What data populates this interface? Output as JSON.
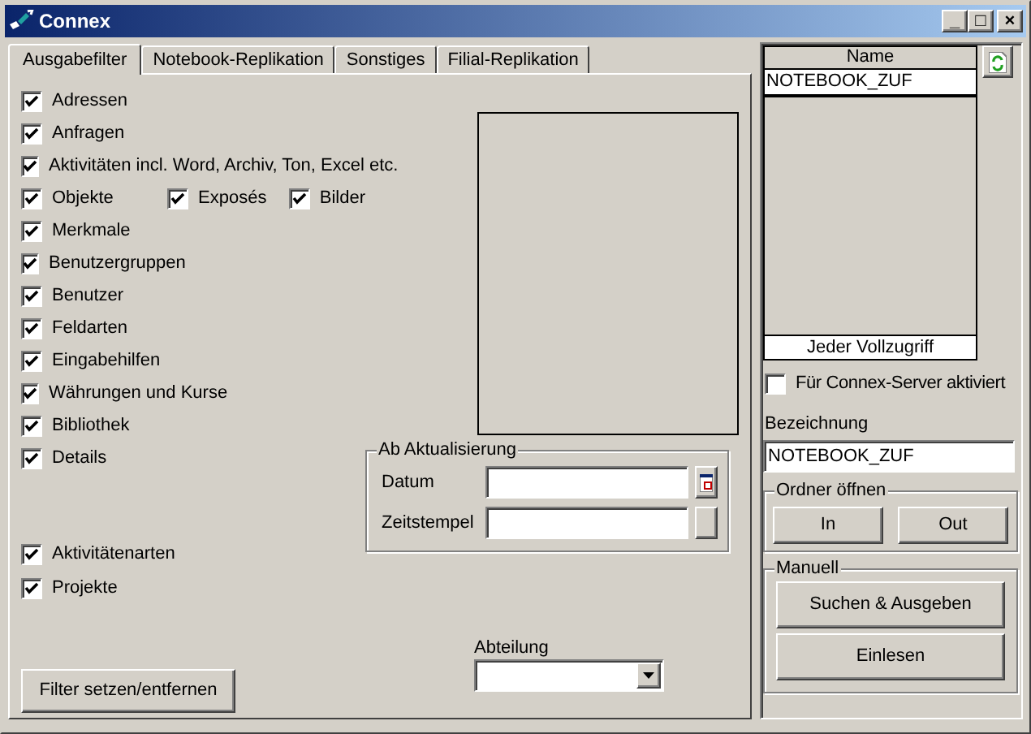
{
  "window": {
    "title": "Connex",
    "controls": [
      "_",
      "□",
      "×"
    ]
  },
  "tabs": [
    {
      "label": "Ausgabefilter",
      "selected": true
    },
    {
      "label": "Notebook-Replikation",
      "selected": false
    },
    {
      "label": "Sonstiges",
      "selected": false
    },
    {
      "label": "Filial-Replikation",
      "selected": false
    }
  ],
  "filters": [
    {
      "label": "Adressen",
      "checked": true
    },
    {
      "label": "Anfragen",
      "checked": true
    },
    {
      "label": "Aktivitäten incl. Word, Archiv, Ton, Excel etc.",
      "checked": true
    },
    {
      "label": "Objekte",
      "checked": true,
      "sub": [
        {
          "label": "Exposés",
          "checked": true
        },
        {
          "label": "Bilder",
          "checked": true
        }
      ]
    },
    {
      "label": "Merkmale",
      "checked": true
    },
    {
      "label": "Benutzergruppen",
      "checked": true
    },
    {
      "label": "Benutzer",
      "checked": true
    },
    {
      "label": "Feldarten",
      "checked": true
    },
    {
      "label": "Eingabehilfen",
      "checked": true
    },
    {
      "label": "Währungen und Kurse",
      "checked": true
    },
    {
      "label": "Bibliothek",
      "checked": true
    },
    {
      "label": "Details",
      "checked": true
    }
  ],
  "filters_2": [
    {
      "label": "Aktivitätenarten",
      "checked": true
    },
    {
      "label": "Projekte",
      "checked": true
    }
  ],
  "filter_button": "Filter setzen/entfernen",
  "update_group": {
    "title": "Ab Aktualisierung",
    "fields": [
      {
        "label": "Datum",
        "kind": "date"
      },
      {
        "label": "Zeitstempel",
        "kind": "time"
      }
    ]
  },
  "department": {
    "label": "Abteilung"
  },
  "list": {
    "column": "Name",
    "rows": [
      {
        "name": "NOTEBOOK_ZUF",
        "selected": true
      }
    ],
    "footer": "Jeder Vollzugriff"
  },
  "server_checkbox": {
    "label": "Für Connex-Server aktiviert",
    "checked": false
  },
  "name_field": {
    "label": "Bezeichnung",
    "value": "NOTEBOOK_ZUF"
  },
  "folder_group": {
    "title": "Ordner öffnen",
    "buttons": [
      "In",
      "Out"
    ]
  },
  "manual_group": {
    "title": "Manuell",
    "buttons": [
      "Suchen & Ausgeben",
      "Einlesen"
    ]
  }
}
